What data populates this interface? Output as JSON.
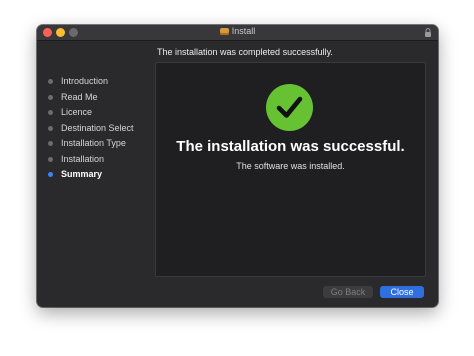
{
  "window": {
    "title": "Install"
  },
  "header": {
    "message": "The installation was completed successfully."
  },
  "sidebar": {
    "steps": [
      {
        "label": "Introduction",
        "active": false
      },
      {
        "label": "Read Me",
        "active": false
      },
      {
        "label": "Licence",
        "active": false
      },
      {
        "label": "Destination Select",
        "active": false
      },
      {
        "label": "Installation Type",
        "active": false
      },
      {
        "label": "Installation",
        "active": false
      },
      {
        "label": "Summary",
        "active": true
      }
    ]
  },
  "main": {
    "title": "The installation was successful.",
    "subtitle": "The software was installed."
  },
  "buttons": {
    "back": "Go Back",
    "close": "Close"
  },
  "colors": {
    "accent": "#2f6fde",
    "success": "#66c233",
    "active_step": "#3b82f6"
  },
  "icons": {
    "title_icon": "package-icon",
    "status_icon": "checkmark-icon",
    "lock": "lock-icon"
  }
}
